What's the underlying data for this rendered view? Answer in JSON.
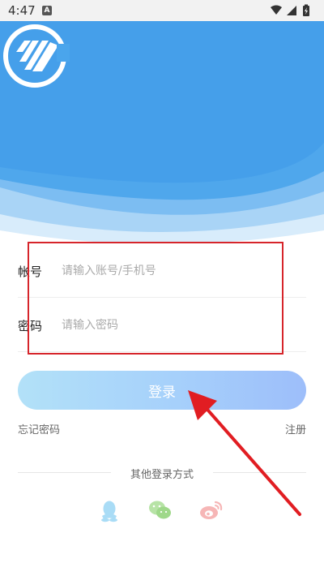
{
  "status_bar": {
    "time": "4:47",
    "app_icon_letter": "A"
  },
  "form": {
    "account": {
      "label": "帐号",
      "placeholder": "请输入账号/手机号"
    },
    "password": {
      "label": "密码",
      "placeholder": "请输入密码"
    }
  },
  "actions": {
    "login_label": "登录",
    "forgot_password": "忘记密码",
    "register": "注册"
  },
  "other_login": {
    "label": "其他登录方式",
    "icons": [
      "qq-icon",
      "wechat-icon",
      "weibo-icon"
    ]
  },
  "colors": {
    "header_blue": "#4aa8ec",
    "button_gradient_start": "#b2e1f8",
    "button_gradient_end": "#9dbefa",
    "annotation_red": "#d6252b"
  }
}
